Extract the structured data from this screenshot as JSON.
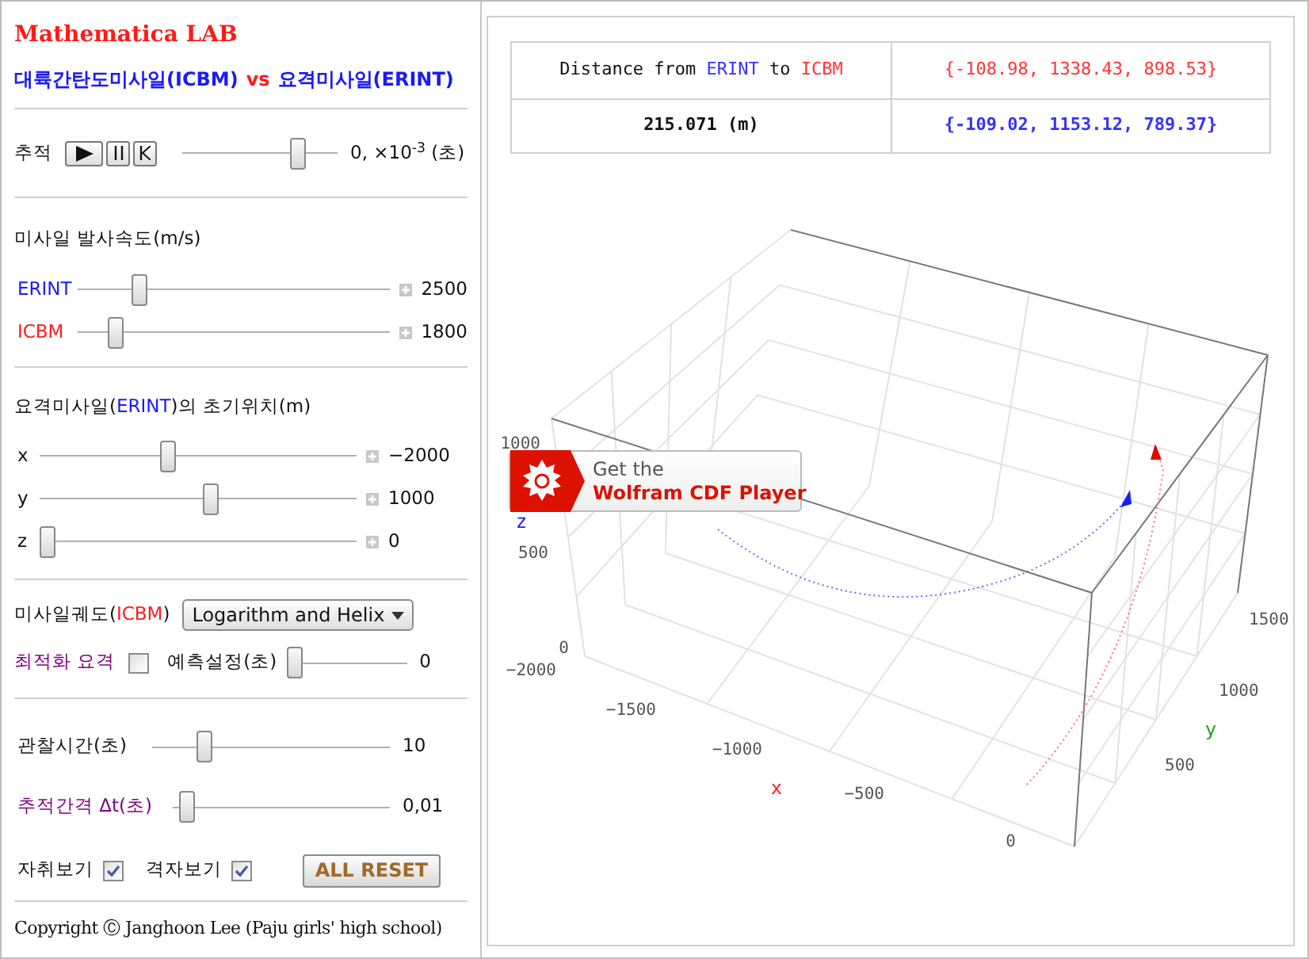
{
  "app_title": "Mathematica LAB",
  "subtitle": [
    {
      "text": "대륙간탄도미사일(ICBM)",
      "color": "#1a1aff"
    },
    {
      "text": "vs",
      "color": "#ff1a1a"
    },
    {
      "text": "요격미사일(ERINT)",
      "color": "#1a1aff"
    }
  ],
  "tracking": {
    "label": "추적",
    "level": 0.77,
    "reading": "0, ×10$^{-3}$ (초)"
  },
  "speed": {
    "title": "미사일 발사속도(m/s)",
    "sliders": [
      {
        "label": "ERINT",
        "color": "#1a1aff",
        "level": 0.18,
        "reading": "2500",
        "expandable": true
      },
      {
        "label": "ICBM",
        "color": "#ff1a1a",
        "level": 0.1,
        "reading": "1800",
        "expandable": true
      }
    ]
  },
  "position": {
    "title": [
      {
        "text": "요격미사일(",
        "color": "#111111"
      },
      {
        "text": "ERINT",
        "color": "#1a1aff"
      },
      {
        "text": ")의 초기위치(m)",
        "color": "#111111"
      }
    ],
    "sliders": [
      {
        "label": "x",
        "color": "#111111",
        "level": 0.4,
        "reading": "−2000",
        "expandable": true
      },
      {
        "label": "y",
        "color": "#111111",
        "level": 0.54,
        "reading": "1000",
        "expandable": true
      },
      {
        "label": "z",
        "color": "#111111",
        "level": 0,
        "reading": "0",
        "expandable": true
      }
    ]
  },
  "trajectory": {
    "label": [
      {
        "text": "미사일궤도(",
        "color": "#111111"
      },
      {
        "text": "ICBM",
        "color": "#ff1a1a"
      },
      {
        "text": ")",
        "color": "#111111"
      }
    ],
    "value": "Logarithm and Helix"
  },
  "optimize": {
    "label": "최적화 요격",
    "checked": false
  },
  "prediction": {
    "label": "예측설정(초)",
    "level": 0,
    "reading": "0"
  },
  "observation": {
    "label": "관찰시간(초)",
    "color": "#111111",
    "level": 0.2,
    "reading": "10"
  },
  "interval": {
    "label": "추적간격 Δt(초)",
    "color": "#800080",
    "level": 0.03,
    "reading": "0,01"
  },
  "toggles": [
    {
      "label": "자취보기",
      "checked": true
    },
    {
      "label": "격자보기",
      "checked": true
    }
  ],
  "reset_button": "ALL RESET",
  "copyright": "Copyright Ⓒ Janghoon Lee (Paju girls' high school)",
  "table": {
    "rows": [
      {
        "cells": [
          [
            {
              "text": "Distance from ",
              "color": "#111111"
            },
            {
              "text": "ERINT",
              "color": "#3333ff"
            },
            {
              "text": " to ",
              "color": "#111111"
            },
            {
              "text": "ICBM",
              "color": "#ff3333"
            }
          ],
          [
            {
              "text": "{-108.98, 1338.43, 898.53}",
              "color": "#ff3333"
            }
          ]
        ],
        "bold": false
      },
      {
        "cells": [
          [
            {
              "text": "215.071 (m)",
              "color": "#111111"
            }
          ],
          [
            {
              "text": "{-109.02, 1153.12, 789.37}",
              "color": "#3333ff"
            }
          ]
        ],
        "bold": true
      }
    ]
  },
  "plot": {
    "x_label": "x",
    "y_label": "y",
    "z_label": "z",
    "x_ticks": [
      "−2000",
      "−1500",
      "−1000",
      "−500",
      "0"
    ],
    "y_ticks": [
      "500",
      "1000",
      "1500"
    ],
    "z_ticks": [
      "0",
      "500",
      "1000"
    ],
    "cdf_badge": {
      "line1": "Get the",
      "line2": "Wolfram CDF Player"
    }
  }
}
